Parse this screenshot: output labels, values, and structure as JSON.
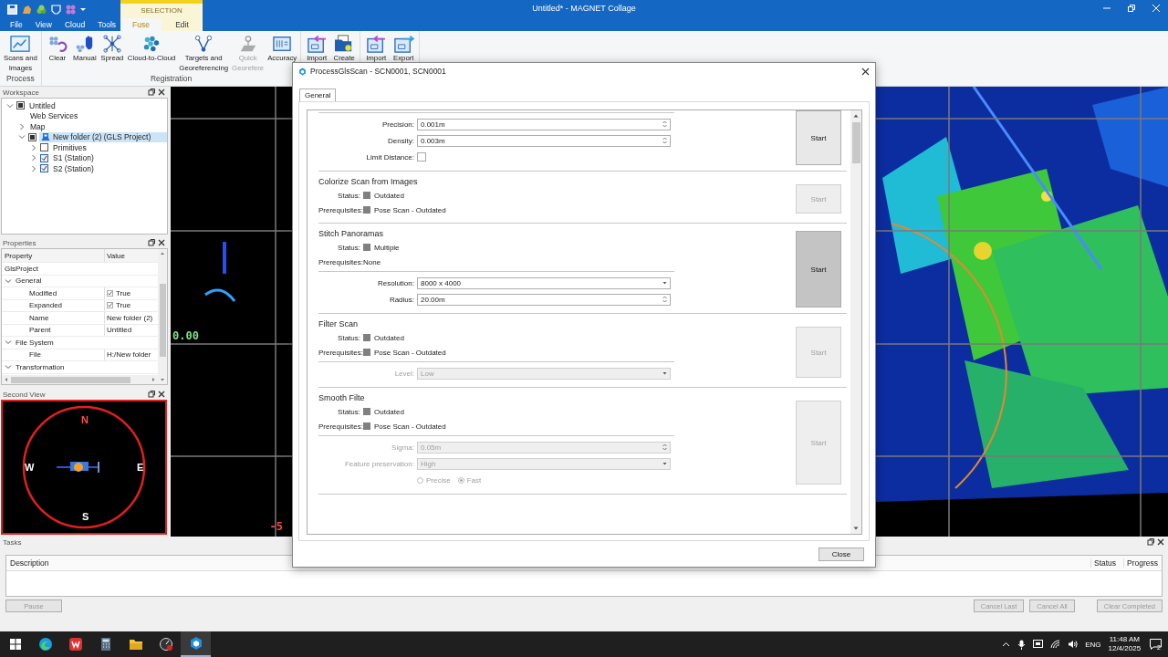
{
  "app": {
    "title": "Untitled* - MAGNET Collage"
  },
  "menu_tabs": [
    {
      "label": "File",
      "selected": false
    },
    {
      "label": "View",
      "selected": false
    },
    {
      "label": "Cloud",
      "selected": false
    },
    {
      "label": "Tools",
      "selected": false
    }
  ],
  "contextual": {
    "title": "SELECTION",
    "tabs": [
      {
        "label": "Fuse",
        "selected": true
      },
      {
        "label": "Edit",
        "selected": false
      }
    ]
  },
  "ribbon": {
    "groups": [
      {
        "title": "Process",
        "buttons": [
          {
            "kind": "chart",
            "lines": [
              "Scans and",
              "Images"
            ],
            "disabled": false
          }
        ]
      },
      {
        "title": "Registration",
        "buttons": [
          {
            "kind": "clear",
            "lines": [
              "Clear"
            ],
            "disabled": false
          },
          {
            "kind": "hand",
            "lines": [
              "Manual"
            ],
            "disabled": false
          },
          {
            "kind": "network",
            "lines": [
              "Spread"
            ],
            "disabled": false
          },
          {
            "kind": "cloud",
            "lines": [
              "Cloud-to-Cloud"
            ],
            "disabled": false
          },
          {
            "kind": "targets",
            "lines": [
              "Targets and",
              "Georeferencing"
            ],
            "disabled": false
          },
          {
            "kind": "pin",
            "lines": [
              "Quick",
              "Georefere"
            ],
            "disabled": true
          },
          {
            "kind": "doc",
            "lines": [
              "Accuracy"
            ],
            "disabled": false
          }
        ]
      },
      {
        "buttons": [
          {
            "kind": "import",
            "lines": [
              "Import"
            ],
            "disabled": false
          },
          {
            "kind": "folder",
            "lines": [
              "Create"
            ],
            "disabled": false
          }
        ]
      },
      {
        "buttons": [
          {
            "kind": "import",
            "lines": [
              "Import"
            ],
            "disabled": false
          },
          {
            "kind": "export",
            "lines": [
              "Export"
            ],
            "disabled": false
          }
        ]
      }
    ]
  },
  "workspace": {
    "title": "Workspace",
    "tree": [
      {
        "label": "Untitled",
        "kind": "item",
        "expanded": true,
        "checked": false,
        "mixed": true,
        "selected": false,
        "children": [
          {
            "label": "Web Services",
            "kind": "item",
            "selected": false
          },
          {
            "label": "Map",
            "kind": "item",
            "expanded": false,
            "selected": false
          },
          {
            "label": "New folder (2) (GLS Project)",
            "kind": "project",
            "expanded": true,
            "checked": false,
            "mixed": true,
            "selected": true,
            "children": [
              {
                "label": "Primitives",
                "kind": "item",
                "expanded": false,
                "checked": false,
                "mixed": false,
                "selected": false
              },
              {
                "label": "S1 (Station)",
                "kind": "item",
                "expanded": false,
                "checked": true,
                "mixed": false,
                "selected": false
              },
              {
                "label": "S2 (Station)",
                "kind": "item",
                "expanded": false,
                "checked": true,
                "mixed": false,
                "selected": false
              }
            ]
          }
        ]
      }
    ]
  },
  "properties": {
    "title": "Properties",
    "columns": [
      "Property",
      "Value"
    ],
    "rows": [
      {
        "kind": "object",
        "name": "GlsProject"
      },
      {
        "kind": "category",
        "name": "General",
        "expanded": true
      },
      {
        "kind": "bool",
        "name": "Modified",
        "value": "True",
        "checked": true
      },
      {
        "kind": "bool",
        "name": "Expanded",
        "value": "True",
        "checked": true
      },
      {
        "kind": "text",
        "name": "Name",
        "value": "New folder (2)"
      },
      {
        "kind": "text",
        "name": "Parent",
        "value": "Untitled"
      },
      {
        "kind": "category",
        "name": "File System",
        "expanded": true
      },
      {
        "kind": "text",
        "name": "File",
        "value": "H:/New folder"
      },
      {
        "kind": "category",
        "name": "Transformation",
        "expanded": true
      }
    ]
  },
  "second_view": {
    "title": "Second View",
    "n": "N",
    "e": "E",
    "s": "S",
    "w": "W"
  },
  "viewport": {
    "labels": [
      {
        "kind": "zero",
        "text": "0.00"
      },
      {
        "kind": "negative",
        "text": "-5"
      }
    ]
  },
  "dialog": {
    "title": "ProcessGlsScan - SCN0001, SCN0001",
    "tabs": [
      {
        "label": "General",
        "selected": true
      }
    ],
    "close_label": "Close",
    "sections": [
      {
        "params": [
          {
            "kind": "spin",
            "label": "Precision:",
            "value": "0.001m",
            "disabled": false
          },
          {
            "kind": "spin",
            "label": "Density:",
            "value": "0.003m",
            "disabled": false
          },
          {
            "kind": "checkbox",
            "label": "Limit Distance:",
            "checked": false
          }
        ],
        "start": {
          "label": "Start",
          "disabled": false,
          "hovered": false
        }
      },
      {
        "title": "Colorize Scan from Images",
        "status": [
          {
            "label": "Status:",
            "value": "Outdated",
            "square": true
          },
          {
            "label": "Prerequisites:",
            "value": "Pose Scan - Outdated",
            "square": true
          }
        ],
        "start": {
          "label": "Start",
          "disabled": true,
          "hovered": false
        }
      },
      {
        "title": "Stitch Panoramas",
        "status": [
          {
            "label": "Status:",
            "value": "Multiple",
            "square": true
          },
          {
            "label": "Prerequisites:",
            "value": "None",
            "square": false
          }
        ],
        "params": [
          {
            "kind": "dropdown",
            "label": "Resolution:",
            "value": "8000 x 4000",
            "disabled": false
          },
          {
            "kind": "spin",
            "label": "Radius:",
            "value": "20.00m",
            "disabled": false
          }
        ],
        "start": {
          "label": "Start",
          "disabled": false,
          "hovered": true
        }
      },
      {
        "title": "Filter Scan",
        "status": [
          {
            "label": "Status:",
            "value": "Outdated",
            "square": true
          },
          {
            "label": "Prerequisites:",
            "value": "Pose Scan - Outdated",
            "square": true
          }
        ],
        "params": [
          {
            "kind": "dropdown",
            "label": "Level:",
            "value": "Low",
            "disabled": true
          }
        ],
        "start": {
          "label": "Start",
          "disabled": true,
          "hovered": false
        }
      },
      {
        "title": "Smooth Filte",
        "status": [
          {
            "label": "Status:",
            "value": "Outdated",
            "square": true
          },
          {
            "label": "Prerequisites:",
            "value": "Pose Scan - Outdated",
            "square": true
          }
        ],
        "params": [
          {
            "kind": "spin",
            "label": "Sigma:",
            "value": "0.05m",
            "disabled": true
          },
          {
            "kind": "dropdown",
            "label": "Feature preservation:",
            "value": "High",
            "disabled": true
          },
          {
            "kind": "radios",
            "disabled": true,
            "options": [
              {
                "label": "Precise",
                "selected": false
              },
              {
                "label": "Fast",
                "selected": true
              }
            ]
          }
        ],
        "start": {
          "label": "Start",
          "disabled": true,
          "hovered": false
        }
      }
    ]
  },
  "tasks": {
    "title": "Tasks",
    "columns": [
      "Description",
      "Status",
      "Progress"
    ],
    "buttons": [
      {
        "label": "Pause",
        "disabled": true
      },
      {
        "label": "Cancel Last",
        "disabled": true
      },
      {
        "label": "Cancel All",
        "disabled": true
      },
      {
        "label": "Clear Completed",
        "disabled": true
      }
    ]
  },
  "taskbar": {
    "apps": [
      {
        "kind": "edge",
        "active": false
      },
      {
        "kind": "office",
        "active": false
      },
      {
        "kind": "calculator",
        "active": false
      },
      {
        "kind": "folder",
        "active": false
      },
      {
        "kind": "gauge",
        "active": false
      },
      {
        "kind": "magnet",
        "active": true
      }
    ],
    "language": "ENG",
    "time": "11:48 AM",
    "date": "12/4/2025",
    "notifications": "2"
  }
}
